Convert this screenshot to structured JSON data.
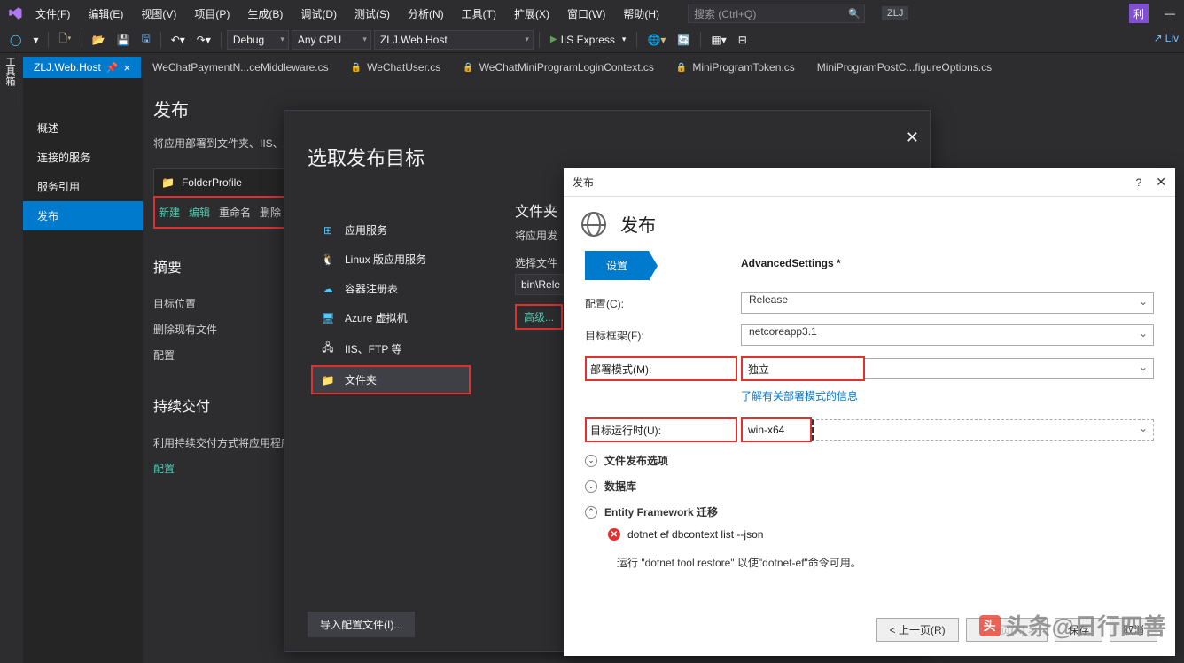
{
  "menu": {
    "file": "文件(F)",
    "edit": "编辑(E)",
    "view": "视图(V)",
    "project": "项目(P)",
    "build": "生成(B)",
    "debug": "调试(D)",
    "test": "测试(S)",
    "analyze": "分析(N)",
    "tools": "工具(T)",
    "extensions": "扩展(X)",
    "window": "窗口(W)",
    "help": "帮助(H)"
  },
  "search": {
    "placeholder": "搜索 (Ctrl+Q)"
  },
  "branding": {
    "zlj": "ZLJ",
    "user": "利"
  },
  "toolbar": {
    "debug": "Debug",
    "anycpu": "Any CPU",
    "project": "ZLJ.Web.Host",
    "iis": "IIS Express",
    "live": "Liv"
  },
  "tabs": {
    "active": "ZLJ.Web.Host",
    "t1": "WeChatPaymentN...ceMiddleware.cs",
    "t2": "WeChatUser.cs",
    "t3": "WeChatMiniProgramLoginContext.cs",
    "t4": "MiniProgramToken.cs",
    "t5": "MiniProgramPostC...figureOptions.cs"
  },
  "sidetool": "工具箱",
  "leftnav": {
    "overview": "概述",
    "services": "连接的服务",
    "references": "服务引用",
    "publish": "发布"
  },
  "publish": {
    "title": "发布",
    "desc": "将应用部署到文件夹、IIS、Az",
    "profile": "FolderProfile",
    "new": "新建",
    "edit": "编辑",
    "rename": "重命名",
    "delete": "删除",
    "summary": "摘要",
    "targetloc": "目标位置",
    "delexist": "删除现有文件",
    "config": "配置",
    "cd": "持续交付",
    "cddesc": "利用持续交付方式将应用程序",
    "cdconfig": "配置"
  },
  "selectTarget": {
    "title": "选取发布目标",
    "appservice": "应用服务",
    "linuxapp": "Linux 版应用服务",
    "registry": "容器注册表",
    "azurevm": "Azure 虚拟机",
    "iisftp": "IIS、FTP 等",
    "folder": "文件夹",
    "filesec": "文件夹",
    "filedesc": "将应用发",
    "choose": "选择文件",
    "path": "bin\\Rele",
    "advanced": "高级...",
    "import": "导入配置文件(I)..."
  },
  "pubdlg": {
    "title": "发布",
    "bigtitle": "发布",
    "settings": "设置",
    "advSettings": "AdvancedSettings *",
    "cfgLabel": "配置(C):",
    "cfgVal": "Release",
    "fwLabel": "目标框架(F):",
    "fwVal": "netcoreapp3.1",
    "modeLabel": "部署模式(M):",
    "modeVal": "独立",
    "modeInfo": "了解有关部署模式的信息",
    "rtLabel": "目标运行时(U):",
    "rtVal": "win-x64",
    "fileopt": "文件发布选项",
    "db": "数据库",
    "ef": "Entity Framework 迁移",
    "efcmd": "dotnet ef dbcontext list --json",
    "efnote": "运行 \"dotnet tool restore\" 以使\"dotnet-ef\"命令可用。",
    "back": "< 上一页(R)",
    "next": "下一页(X) >",
    "save": "保存",
    "cancel": "取消"
  },
  "watermark": "头条@日行四善"
}
